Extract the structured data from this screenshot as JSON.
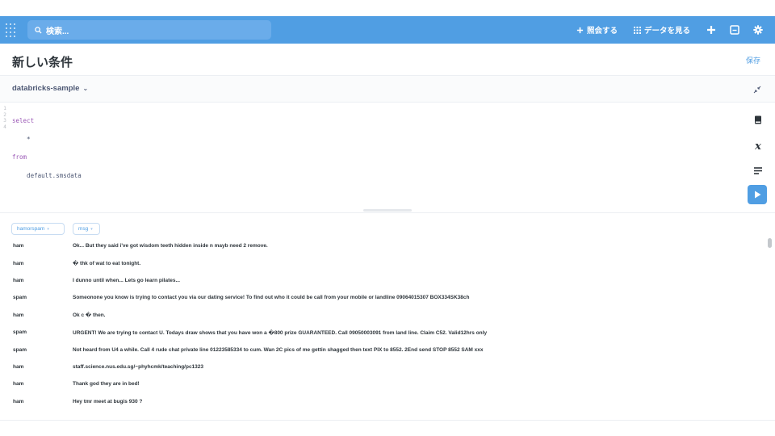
{
  "topbar": {
    "search_placeholder": "検索...",
    "ask_button_label": "照会する",
    "browse_button_label": "データを見る",
    "new_icon": "plus-icon",
    "snippets_icon": "snippet-icon",
    "settings_icon": "gear-icon"
  },
  "header": {
    "title": "新しい条件",
    "save_label": "保存"
  },
  "database": {
    "selected": "databricks-sample"
  },
  "editor": {
    "line_numbers": [
      "1",
      "2",
      "3",
      "4"
    ],
    "lines": {
      "l1": "select",
      "l2": "    *",
      "l3": "from",
      "l4_prefix": "    default.",
      "l4_table": "smsdata"
    }
  },
  "results": {
    "columns": [
      "hamorspam",
      "msg"
    ],
    "rows": [
      [
        "ham",
        "Ok... But they said i've got wisdom teeth hidden inside n mayb need 2 remove."
      ],
      [
        "ham",
        "� thk of wat to eat tonight."
      ],
      [
        "ham",
        "I dunno until when... Lets go learn pilates..."
      ],
      [
        "spam",
        "Someonone you know is trying to contact you via our dating service! To find out who it could be call from your mobile or landline 09064015307 BOX334SK38ch"
      ],
      [
        "ham",
        "Ok c � then."
      ],
      [
        "spam",
        "URGENT! We are trying to contact U. Todays draw shows that you have won a �800 prize GUARANTEED. Call 09050003091 from land line. Claim C52. Valid12hrs only"
      ],
      [
        "spam",
        "Not heard from U4 a while. Call 4 rude chat private line 01223585334 to cum. Wan 2C pics of me gettin shagged then text PIX to 8552. 2End send STOP 8552 SAM xxx"
      ],
      [
        "ham",
        "staff.science.nus.edu.sg/~phyhcmk/teaching/pc1323"
      ],
      [
        "ham",
        "Thank god they are in bed!"
      ],
      [
        "ham",
        "Hey tmr meet at bugis 930 ?"
      ]
    ]
  },
  "colors": {
    "brand": "#509ee3",
    "keyword": "#9b59b6"
  }
}
